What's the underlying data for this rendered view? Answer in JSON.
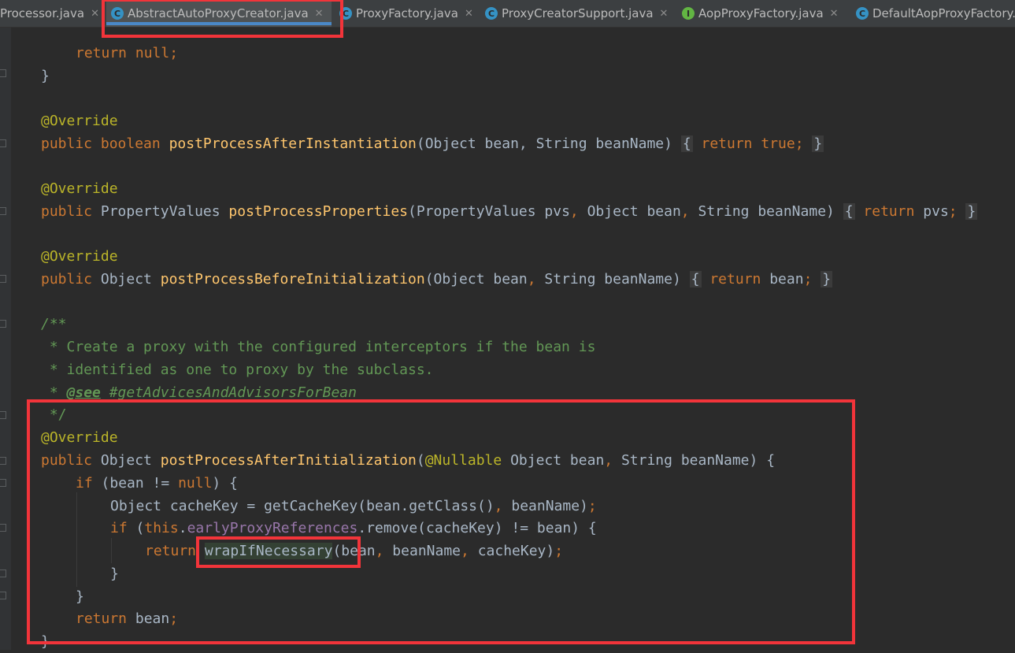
{
  "tabs": [
    {
      "label": "Processor.java",
      "icon": "class-icon",
      "active": false
    },
    {
      "label": "AbstractAutoProxyCreator.java",
      "icon": "abstract-class-icon",
      "active": true
    },
    {
      "label": "ProxyFactory.java",
      "icon": "class-icon",
      "active": false
    },
    {
      "label": "ProxyCreatorSupport.java",
      "icon": "class-icon",
      "active": false
    },
    {
      "label": "AopProxyFactory.java",
      "icon": "interface-icon",
      "active": false
    },
    {
      "label": "DefaultAopProxyFactory.",
      "icon": "class-icon",
      "active": false
    }
  ],
  "code": {
    "l1": {
      "kw": "return",
      "kw2": "null",
      "p": ";"
    },
    "l2": "}",
    "l3": "@Override",
    "l4": {
      "kw": "public",
      "kw2": "boolean",
      "fn": "postProcessAfterInstantiation",
      "params": "(Object bean, String beanName)",
      "ob": "{",
      "ret": "return",
      "val": "true",
      "semi": ";",
      "cb": "}"
    },
    "l5": "@Override",
    "l6": {
      "kw": "public",
      "type": " PropertyValues ",
      "fn": "postProcessProperties",
      "params1": "(PropertyValues pvs",
      "params2": " Object bean",
      "params3": " String beanName)",
      "comma": ",",
      "ob": "{",
      "ret": "return",
      "val": " pvs",
      "semi": ";",
      "cb": "}"
    },
    "l7": "@Override",
    "l8": {
      "kw": "public",
      "type": " Object ",
      "fn": "postProcessBeforeInitialization",
      "params1": "(Object bean",
      "params2": " String beanName)",
      "comma": ",",
      "ob": "{",
      "ret": "return",
      "val": " bean",
      "semi": ";",
      "cb": "}"
    },
    "c1": "/**",
    "c2": " * Create a proxy with the configured interceptors if the bean is",
    "c3": " * identified as one to proxy by the subclass.",
    "c4pre": " * ",
    "c4tag": "@see",
    "c4ref": " #getAdvicesAndAdvisorsForBean",
    "c5": " */",
    "l9": "@Override",
    "l10": {
      "kw": "public",
      "type": " Object ",
      "fn": "postProcessAfterInitialization",
      "open": "(",
      "ann": "@Nullable",
      "rest1": " Object bean",
      "comma": ",",
      "rest2": " String beanName) {"
    },
    "l11": {
      "kw": "if",
      "a": " (bean != ",
      "kw2": "null",
      "b": ") {"
    },
    "l12": {
      "a": "Object cacheKey = getCacheKey(bean.getClass()",
      "comma": ",",
      "b": " beanName)",
      "semi": ";"
    },
    "l13": {
      "kw": "if",
      "a": " (",
      "kw2": "this",
      "dot": ".",
      "field": "earlyProxyReferences",
      "b": ".remove(cacheKey) != bean) {"
    },
    "l14": {
      "kw": "return",
      "sp": " ",
      "hl": "wrapIfNecessary",
      "a": "(bean",
      "c1": ",",
      "b": " beanName",
      "c2": ",",
      "c": " cacheKey)",
      "semi": ";"
    },
    "l15": "}",
    "l16": "}",
    "l17": {
      "kw": "return",
      "a": " bean",
      "semi": ";"
    },
    "l18": "}"
  },
  "colors": {
    "keyword": "#cc7832",
    "annotation": "#bbb529",
    "method": "#ffc66d",
    "field": "#9876aa",
    "comment": "#629755",
    "highlight_box": "#f2343a"
  }
}
